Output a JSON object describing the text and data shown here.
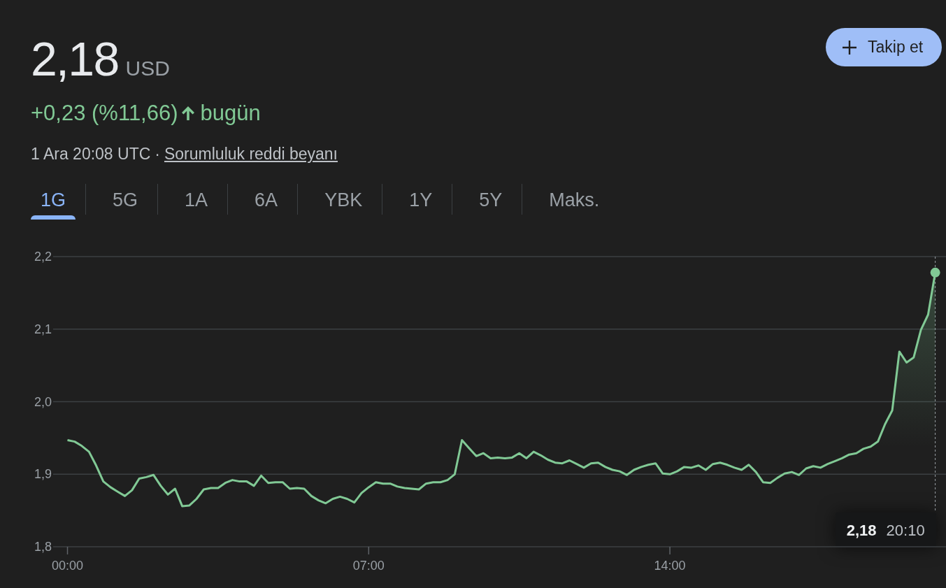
{
  "quote": {
    "price": "2,18",
    "currency": "USD",
    "change": "+0,23 (%11,66)",
    "positive": true,
    "period": "bugün",
    "timestamp": "1 Ara 20:08 UTC",
    "separator": "·",
    "disclaimer_link": "Sorumluluk reddi beyanı"
  },
  "follow_button": {
    "label": "Takip et"
  },
  "range_tabs": [
    {
      "label": "1G",
      "selected": true
    },
    {
      "label": "5G",
      "selected": false
    },
    {
      "label": "1A",
      "selected": false
    },
    {
      "label": "6A",
      "selected": false
    },
    {
      "label": "YBK",
      "selected": false
    },
    {
      "label": "1Y",
      "selected": false
    },
    {
      "label": "5Y",
      "selected": false
    },
    {
      "label": "Maks.",
      "selected": false
    }
  ],
  "chart": {
    "chart_data": {
      "type": "line",
      "x": [
        0,
        10,
        20,
        30,
        40,
        50,
        60,
        70,
        80,
        90,
        100,
        110,
        120,
        130,
        140,
        150,
        160,
        170,
        180,
        190,
        200,
        210,
        220,
        230,
        240,
        250,
        260,
        270,
        280,
        290,
        300,
        310,
        320,
        330,
        340,
        350,
        360,
        370,
        380,
        390,
        400,
        410,
        420,
        430,
        440,
        450,
        460,
        470,
        480,
        490,
        500,
        510,
        520,
        530,
        540,
        550,
        560,
        570,
        580,
        590,
        600,
        610,
        620,
        630,
        640,
        650,
        660,
        670,
        680,
        690,
        700,
        710,
        720,
        730,
        740,
        750,
        760,
        770,
        780,
        790,
        800,
        810,
        820,
        830,
        840,
        850,
        860,
        870,
        880,
        890,
        900,
        910,
        920,
        930,
        940,
        950,
        960,
        970,
        980,
        990,
        1000,
        1010,
        1020,
        1030,
        1040,
        1050,
        1060,
        1070,
        1080,
        1090,
        1100,
        1110,
        1120,
        1130,
        1140,
        1150,
        1160,
        1170,
        1180,
        1190,
        1200,
        1210
      ],
      "series": [
        {
          "color": "#81c995",
          "values": [
            1.947,
            1.945,
            1.939,
            1.931,
            1.912,
            1.89,
            1.882,
            1.876,
            1.87,
            1.878,
            1.894,
            1.896,
            1.899,
            1.884,
            1.872,
            1.88,
            1.856,
            1.857,
            1.866,
            1.879,
            1.881,
            1.881,
            1.888,
            1.892,
            1.89,
            1.89,
            1.884,
            1.898,
            1.888,
            1.889,
            1.889,
            1.88,
            1.881,
            1.88,
            1.87,
            1.864,
            1.86,
            1.866,
            1.869,
            1.866,
            1.861,
            1.874,
            1.882,
            1.889,
            1.887,
            1.887,
            1.883,
            1.881,
            1.88,
            1.879,
            1.887,
            1.889,
            1.889,
            1.892,
            1.9,
            1.947,
            1.936,
            1.925,
            1.929,
            1.922,
            1.923,
            1.922,
            1.923,
            1.929,
            1.922,
            1.931,
            1.926,
            1.92,
            1.916,
            1.915,
            1.919,
            1.914,
            1.909,
            1.915,
            1.916,
            1.91,
            1.906,
            1.904,
            1.899,
            1.906,
            1.91,
            1.913,
            1.915,
            1.901,
            1.9,
            1.904,
            1.91,
            1.909,
            1.912,
            1.906,
            1.914,
            1.916,
            1.913,
            1.909,
            1.906,
            1.913,
            1.903,
            1.889,
            1.888,
            1.895,
            1.901,
            1.903,
            1.899,
            1.908,
            1.911,
            1.909,
            1.914,
            1.918,
            1.922,
            1.927,
            1.929,
            1.935,
            1.938,
            1.945,
            1.969,
            1.988,
            2.069,
            2.054,
            2.061,
            2.099,
            2.12,
            2.178
          ]
        }
      ],
      "xlim": [
        -20,
        1225
      ],
      "ylim": [
        1.8,
        2.2
      ],
      "xticks": [
        {
          "value": 0,
          "label": "00:00"
        },
        {
          "value": 420,
          "label": "07:00"
        },
        {
          "value": 840,
          "label": "14:00"
        }
      ],
      "yticks": [
        {
          "value": 1.8,
          "label": "1,8"
        },
        {
          "value": 1.9,
          "label": "1,9"
        },
        {
          "value": 2.0,
          "label": "2,0"
        },
        {
          "value": 2.1,
          "label": "2,1"
        },
        {
          "value": 2.2,
          "label": "2,2"
        }
      ],
      "grid": true,
      "ref_lines": [
        {
          "axis": "x",
          "value": 1210
        }
      ]
    },
    "tooltip": {
      "value": "2,18",
      "time": "20:10"
    }
  }
}
